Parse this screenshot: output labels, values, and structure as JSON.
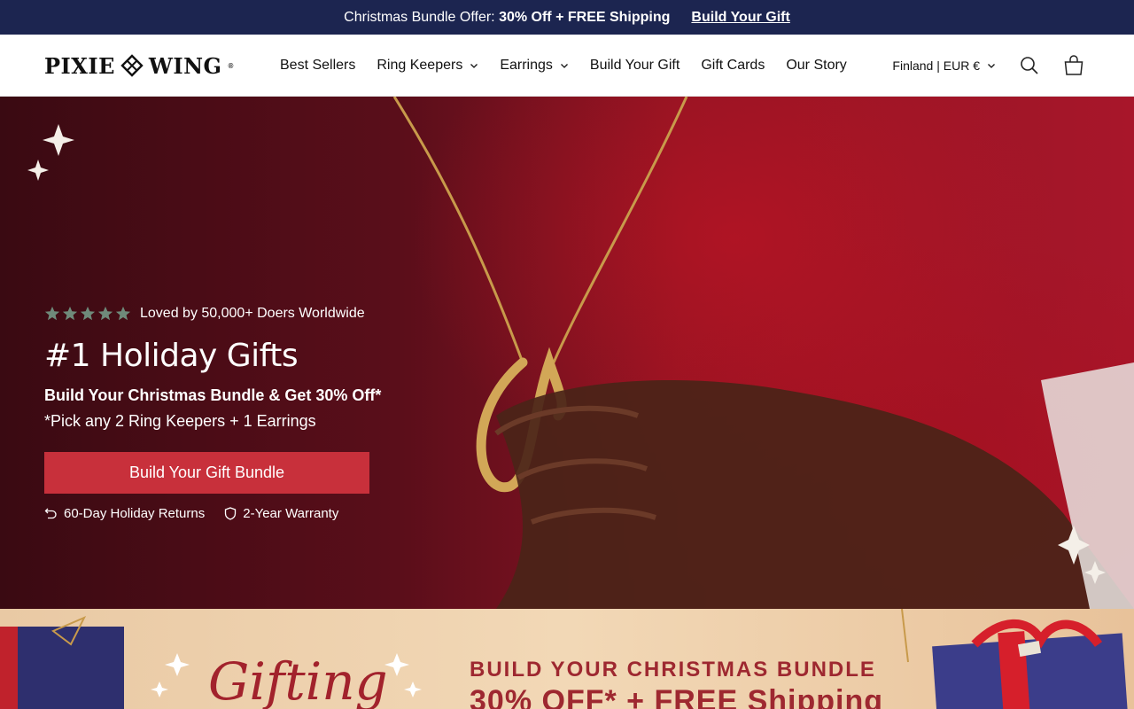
{
  "announcement": {
    "lead": "Christmas Bundle Offer:",
    "highlight": "30% Off + FREE Shipping",
    "link": "Build Your Gift"
  },
  "header": {
    "logo_left": "PIXIE",
    "logo_right": "WING",
    "logo_mark": "®",
    "nav": [
      {
        "label": "Best Sellers"
      },
      {
        "label": "Ring Keepers"
      },
      {
        "label": "Earrings"
      },
      {
        "label": "Build Your Gift"
      },
      {
        "label": "Gift Cards"
      },
      {
        "label": "Our Story"
      }
    ],
    "locale": "Finland | EUR €"
  },
  "hero": {
    "rating_text": "Loved by 50,000+ Doers Worldwide",
    "rating_stars": 5,
    "headline": "#1 Holiday Gifts",
    "subheadline": "Build Your Christmas Bundle & Get 30% Off*",
    "fine_print": "*Pick any 2 Ring Keepers + 1 Earrings",
    "cta": "Build Your Gift Bundle",
    "badges": [
      {
        "label": "60-Day Holiday Returns",
        "icon": "return-arrow-icon"
      },
      {
        "label": "2-Year Warranty",
        "icon": "shield-icon"
      }
    ]
  },
  "promo": {
    "script": "Gifting",
    "title": "BUILD YOUR CHRISTMAS BUNDLE",
    "subtitle": "30% OFF* + FREE Shipping"
  },
  "colors": {
    "announcement_bg": "#1c2550",
    "cta_bg": "#c8303b",
    "star": "#6f8a7a",
    "promo_text": "#9e2830"
  }
}
